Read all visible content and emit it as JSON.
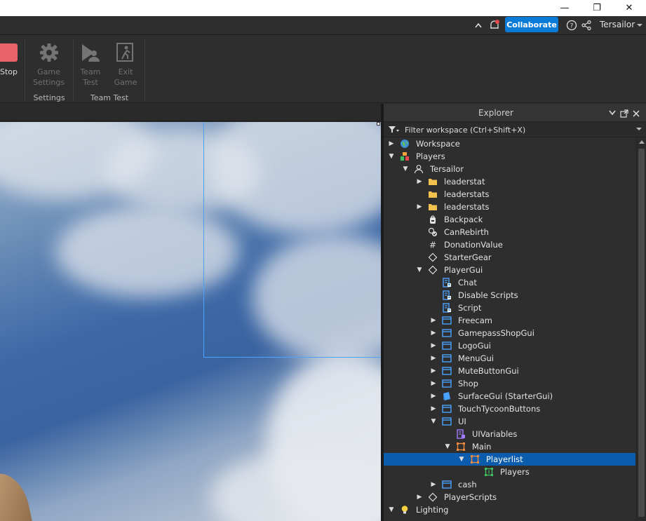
{
  "titlebar": {
    "minimize_glyph": "—",
    "restore_glyph": "❐",
    "close_glyph": "✕"
  },
  "topbar": {
    "collaborate_label": "Collaborate",
    "username": "Tersailor"
  },
  "ribbon": {
    "stop_label": "Stop",
    "game_settings_label": [
      "Game",
      "Settings"
    ],
    "team_test_label": [
      "Team",
      "Test"
    ],
    "exit_game_label": [
      "Exit",
      "Game"
    ],
    "group_settings": "Settings",
    "group_team_test": "Team Test"
  },
  "explorer": {
    "title": "Explorer",
    "filter_placeholder": "Filter workspace (Ctrl+Shift+X)",
    "items": [
      {
        "label": "Workspace",
        "depth": 0,
        "expander": "collapsed",
        "icon": "globe-icon",
        "selected": false
      },
      {
        "label": "Players",
        "depth": 0,
        "expander": "expanded",
        "icon": "players-icon",
        "selected": false
      },
      {
        "label": "Tersailor",
        "depth": 1,
        "expander": "expanded",
        "icon": "player-icon",
        "selected": false
      },
      {
        "label": "leaderstat",
        "depth": 2,
        "expander": "collapsed",
        "icon": "folder-icon",
        "selected": false
      },
      {
        "label": "leaderstats",
        "depth": 2,
        "expander": "none",
        "icon": "folder-icon",
        "selected": false
      },
      {
        "label": "leaderstats",
        "depth": 2,
        "expander": "collapsed",
        "icon": "folder-icon",
        "selected": false
      },
      {
        "label": "Backpack",
        "depth": 2,
        "expander": "none",
        "icon": "backpack-icon",
        "selected": false
      },
      {
        "label": "CanRebirth",
        "depth": 2,
        "expander": "none",
        "icon": "bool-value-icon",
        "selected": false
      },
      {
        "label": "DonationValue",
        "depth": 2,
        "expander": "none",
        "icon": "number-value-icon",
        "selected": false
      },
      {
        "label": "StarterGear",
        "depth": 2,
        "expander": "none",
        "icon": "diamond-icon",
        "selected": false
      },
      {
        "label": "PlayerGui",
        "depth": 2,
        "expander": "expanded",
        "icon": "diamond-icon",
        "selected": false
      },
      {
        "label": "Chat",
        "depth": 3,
        "expander": "none",
        "icon": "local-script-icon",
        "selected": false
      },
      {
        "label": "Disable Scripts",
        "depth": 3,
        "expander": "none",
        "icon": "local-script-icon",
        "selected": false
      },
      {
        "label": "Script",
        "depth": 3,
        "expander": "none",
        "icon": "local-script-icon",
        "selected": false
      },
      {
        "label": "Freecam",
        "depth": 3,
        "expander": "collapsed",
        "icon": "screen-gui-icon",
        "selected": false
      },
      {
        "label": "GamepassShopGui",
        "depth": 3,
        "expander": "collapsed",
        "icon": "screen-gui-icon",
        "selected": false
      },
      {
        "label": "LogoGui",
        "depth": 3,
        "expander": "collapsed",
        "icon": "screen-gui-icon",
        "selected": false
      },
      {
        "label": "MenuGui",
        "depth": 3,
        "expander": "collapsed",
        "icon": "screen-gui-icon",
        "selected": false
      },
      {
        "label": "MuteButtonGui",
        "depth": 3,
        "expander": "collapsed",
        "icon": "screen-gui-icon",
        "selected": false
      },
      {
        "label": "Shop",
        "depth": 3,
        "expander": "collapsed",
        "icon": "screen-gui-icon",
        "selected": false
      },
      {
        "label": "SurfaceGui (StarterGui)",
        "depth": 3,
        "expander": "collapsed",
        "icon": "surface-gui-icon",
        "selected": false
      },
      {
        "label": "TouchTycoonButtons",
        "depth": 3,
        "expander": "collapsed",
        "icon": "screen-gui-icon",
        "selected": false
      },
      {
        "label": "UI",
        "depth": 3,
        "expander": "expanded",
        "icon": "screen-gui-icon",
        "selected": false
      },
      {
        "label": "UIVariables",
        "depth": 4,
        "expander": "none",
        "icon": "module-script-icon",
        "selected": false
      },
      {
        "label": "Main",
        "depth": 4,
        "expander": "expanded",
        "icon": "frame-icon",
        "selected": false
      },
      {
        "label": "Playerlist",
        "depth": 5,
        "expander": "expanded",
        "icon": "frame-icon",
        "selected": true
      },
      {
        "label": "Players",
        "depth": 6,
        "expander": "none",
        "icon": "scrolling-frame-icon",
        "selected": false
      },
      {
        "label": "cash",
        "depth": 3,
        "expander": "collapsed",
        "icon": "screen-gui-icon",
        "selected": false
      },
      {
        "label": "PlayerScripts",
        "depth": 2,
        "expander": "collapsed",
        "icon": "diamond-icon",
        "selected": false
      },
      {
        "label": "Lighting",
        "depth": 0,
        "expander": "expanded",
        "icon": "lightbulb-icon",
        "selected": false
      }
    ]
  },
  "colors": {
    "accent": "#0b7bd8",
    "selection": "#0b5cad",
    "stop_button": "#e8636a",
    "folder": "#f2c14e",
    "gui_icon": "#4aa3ff",
    "frame_orange": "#f08a3c",
    "scrolling_frame_green": "#3fbf5f",
    "module_purple": "#a27bff"
  }
}
